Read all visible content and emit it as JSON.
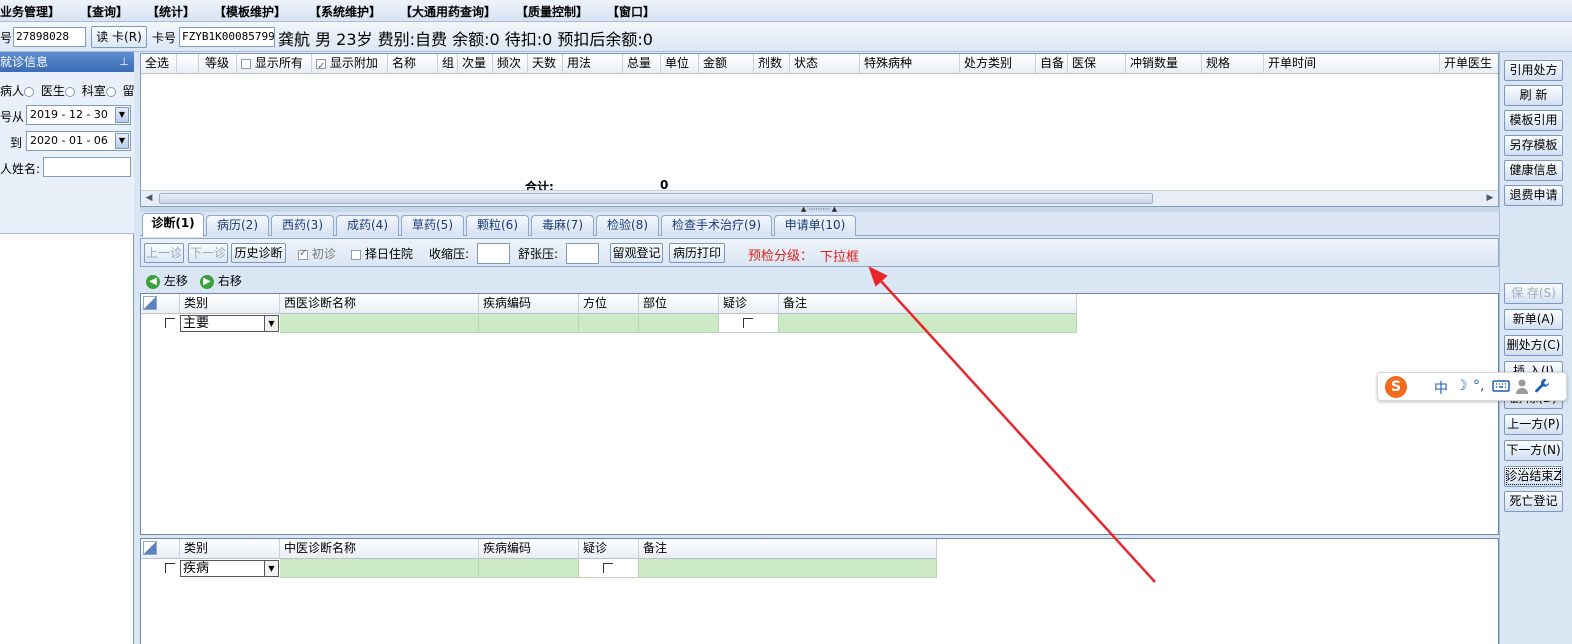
{
  "menu": [
    "业务管理】",
    "【查询】",
    "【统计】",
    "【模板维护】",
    "【系统维护】",
    "【大通用药查询】",
    "【质量控制】",
    "【窗口】"
  ],
  "patient_bar": {
    "id_label": "号",
    "id_value": "27898028",
    "read_card_button": "读 卡(R)",
    "card_label": "卡号",
    "card_value": "FZYB1K00085799",
    "info": "龚航 男 23岁 费别:自费 余额:0 待扣:0 预扣后余额:0"
  },
  "left_panel": {
    "title": "就诊信息",
    "pin_icon": "pin-icon",
    "radio_patient": "病人",
    "radio_doctor": "医生",
    "radio_dept": "科室",
    "radio_stay": "留",
    "from_label": "号从",
    "from_date": "2019 - 12 - 30",
    "to_label": "到",
    "to_date": "2020 - 01 - 06",
    "name_label": "人姓名:",
    "name_value": ""
  },
  "rx_grid": {
    "columns": [
      "全选",
      "",
      "等级",
      "显示所有",
      "显示附加",
      "名称",
      "组",
      "次量",
      "频次",
      "天数",
      "用法",
      "总量",
      "单位",
      "金额",
      "剂数",
      "状态",
      "特殊病种",
      "处方类别",
      "自备",
      "医保",
      "冲销数量",
      "规格",
      "开单时间",
      "开单医生"
    ],
    "show_all_checked": false,
    "show_extra_checked": true,
    "total_label": "合计:",
    "total_value": "0"
  },
  "tabs": [
    "诊断(1)",
    "病历(2)",
    "西药(3)",
    "成药(4)",
    "草药(5)",
    "颗粒(6)",
    "毒麻(7)",
    "检验(8)",
    "检查手术治疗(9)",
    "申请单(10)"
  ],
  "active_tab": 0,
  "diag_toolbar": {
    "prev_button": "上一诊",
    "next_button": "下一诊",
    "history_button": "历史诊断",
    "first_visit_label": "初诊",
    "first_visit_checked": true,
    "hospital_label": "择日住院",
    "systolic_label": "收缩压:",
    "systolic_value": "",
    "diastolic_label": "舒张压:",
    "diastolic_value": "",
    "observe_button": "留观登记",
    "print_button": "病历打印",
    "precheck_label": "预检分级：",
    "precheck_value": "下拉框"
  },
  "move_row": {
    "left_label": "左移",
    "right_label": "右移"
  },
  "western_diag": {
    "columns": [
      "类别",
      "西医诊断名称",
      "疾病编码",
      "方位",
      "部位",
      "疑诊",
      "备注"
    ],
    "row_category": "主要"
  },
  "chinese_diag": {
    "columns": [
      "类别",
      "中医诊断名称",
      "疾病编码",
      "疑诊",
      "备注"
    ],
    "row_category": "疾病"
  },
  "right_toolbar": [
    "引用处方",
    "刷 新",
    "模板引用",
    "另存模板",
    "健康信息",
    "退费申请",
    "保 存(S)",
    "新单(A)",
    "删处方(C)",
    "插 入(I)",
    "删 除(D)",
    "上一方(P)",
    "下一方(N)",
    "诊治结束Z",
    "死亡登记"
  ],
  "ime": {
    "logo": "S",
    "mode": "中",
    "moon": "☽",
    "punct": "°,",
    "keyboard_icon": "keyboard-icon",
    "user_icon": "user-icon",
    "settings_icon": "wrench-icon"
  },
  "colors": {
    "accent_blue": "#3b6cb5",
    "warning_red": "#e0201a",
    "diag_row_green": "#cdeac6",
    "ime_orange": "#f36b1f",
    "arrow_red": "#e8262b"
  }
}
